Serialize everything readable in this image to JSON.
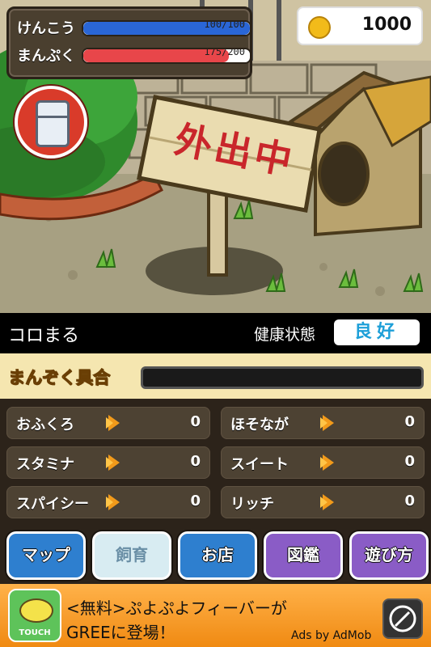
{
  "hud": {
    "health": {
      "label": "けんこう",
      "text": "100/100",
      "fraction": 1.0,
      "color": "#2a66d6"
    },
    "fullness": {
      "label": "まんぷく",
      "text": "175/200",
      "fraction": 0.875,
      "color": "#e8464a"
    }
  },
  "coins": {
    "icon": "coin-icon",
    "value": "1000"
  },
  "fridge_button": {
    "icon": "fridge-icon"
  },
  "sign_text": "外出中",
  "pet": {
    "name": "コロまる",
    "health_label": "健康状態",
    "health_value": "良好"
  },
  "manzoku": {
    "label": "まんぞく具合",
    "fraction": 0.0
  },
  "flavors": [
    {
      "name": "おふくろ",
      "count": "0"
    },
    {
      "name": "ほそなが",
      "count": "0"
    },
    {
      "name": "スタミナ",
      "count": "0"
    },
    {
      "name": "スイート",
      "count": "0"
    },
    {
      "name": "スパイシー",
      "count": "0"
    },
    {
      "name": "リッチ",
      "count": "0"
    }
  ],
  "nav": {
    "map": {
      "label": "マップ",
      "color": "#2e7fcf"
    },
    "raise": {
      "label": "飼育",
      "color": "#d8ecf2"
    },
    "shop": {
      "label": "お店",
      "color": "#2e7fcf"
    },
    "dex": {
      "label": "図鑑",
      "color": "#8a5cc6"
    },
    "howto": {
      "label": "遊び方",
      "color": "#8a5cc6"
    }
  },
  "ad": {
    "line1": "<無料>ぷよぷよフィーバーが",
    "line2": "GREEに登場！",
    "credit": "Ads by AdMob",
    "icon_text": "TOUCH",
    "icon": "compass-icon"
  }
}
